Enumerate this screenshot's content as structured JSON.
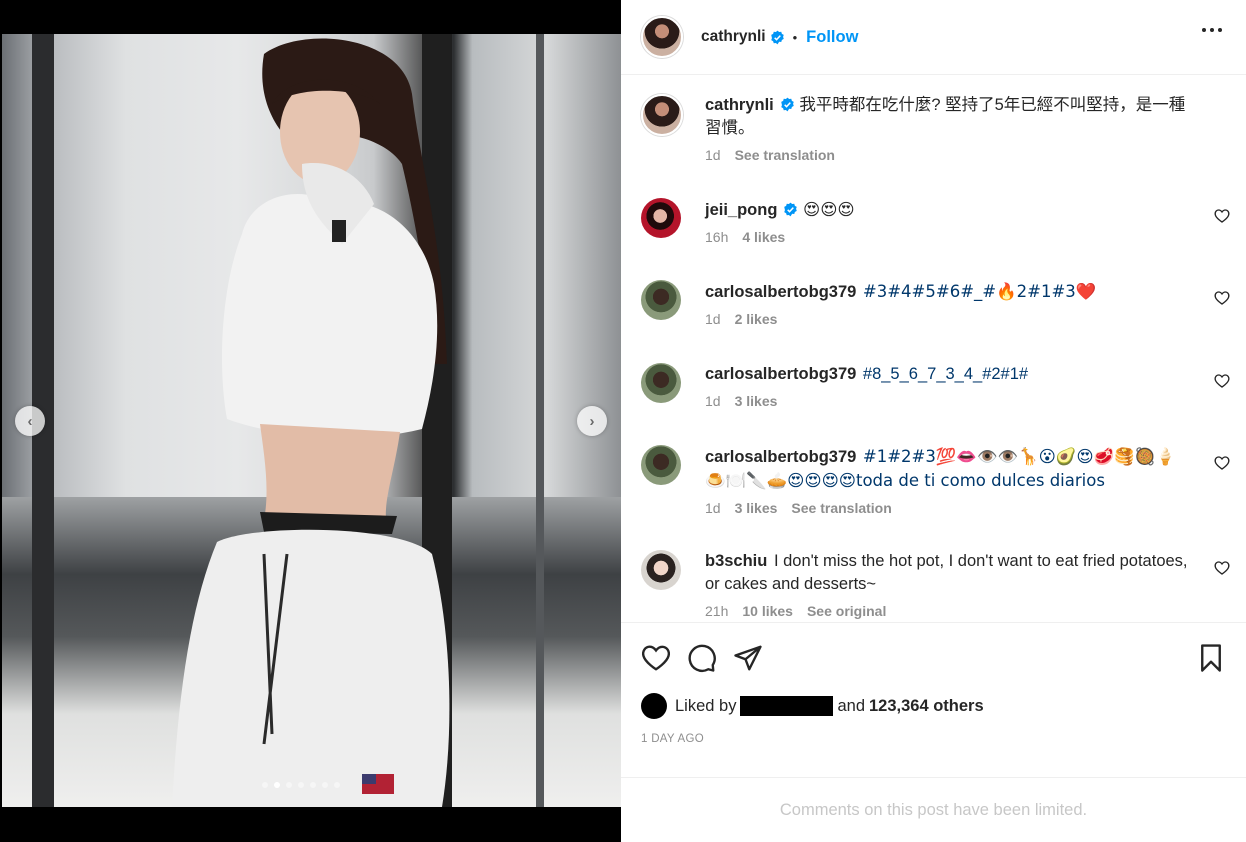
{
  "post": {
    "author": "cathrynli",
    "follow_label": "Follow",
    "separator": "•",
    "caption": {
      "username": "cathrynli",
      "text": "我平時都在吃什麼? 堅持了5年已經不叫堅持，是一種習慣。",
      "time": "1d",
      "see_translation": "See translation"
    },
    "carousel": {
      "slide_count": 7,
      "active_index": 1
    }
  },
  "comments": [
    {
      "username": "jeii_pong",
      "verified": true,
      "text": "😍😍😍",
      "time": "16h",
      "likes": "4 likes"
    },
    {
      "username": "carlosalbertobg379",
      "text": "#3#4#5#6#_#🔥2#1#3❤️",
      "time": "1d",
      "likes": "2 likes"
    },
    {
      "username": "carlosalbertobg379",
      "text": "#8_5_6_7_3_4_#2#1#",
      "time": "1d",
      "likes": "3 likes"
    },
    {
      "username": "carlosalbertobg379",
      "text": "#1#2#3💯👄👁️👁️🦒😮🥑😍🥩🥞🥘🍦🍮🍽️🔪🥧😍😍😍😍toda de ti como dulces diarios",
      "time": "1d",
      "likes": "3 likes",
      "see_translation": "See translation"
    },
    {
      "username": "b3schiu",
      "text": "I don't miss the hot pot, I don't want to eat fried potatoes, or cakes and desserts~",
      "time": "21h",
      "likes": "10 likes",
      "see_original": "See original"
    }
  ],
  "likes": {
    "prefix": "Liked by",
    "connector": "and",
    "count": "123,364 others"
  },
  "date": "1 DAY AGO",
  "comments_limited": "Comments on this post have been limited.",
  "colors": {
    "accent": "#0095f6",
    "verified": "#0095f6",
    "hashtag": "#00376b",
    "muted": "#8e8e8e"
  },
  "icons": [
    "verified-badge-icon",
    "more-options-icon",
    "heart-icon",
    "comment-icon",
    "share-icon",
    "bookmark-icon",
    "chevron-left-icon",
    "chevron-right-icon"
  ]
}
